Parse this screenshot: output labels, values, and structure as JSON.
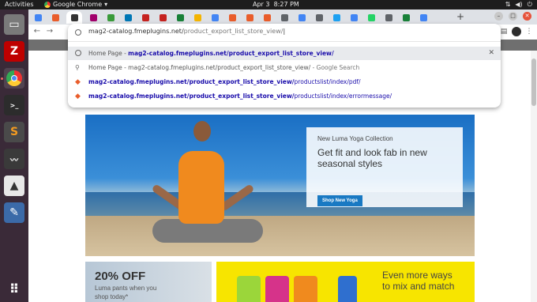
{
  "os_topbar": {
    "activities": "Activities",
    "app_name": "Google Chrome",
    "date": "Apr 3",
    "time": "8:27 PM"
  },
  "dock": {
    "items": [
      {
        "name": "files-icon",
        "glyph": "▭"
      },
      {
        "name": "filezilla-icon",
        "glyph": "Z"
      },
      {
        "name": "chrome-icon",
        "glyph": "◉"
      },
      {
        "name": "terminal-icon",
        "glyph": ">_"
      },
      {
        "name": "sublime-icon",
        "glyph": "S"
      },
      {
        "name": "system-monitor-icon",
        "glyph": "~"
      },
      {
        "name": "app-icon",
        "glyph": "▲"
      },
      {
        "name": "screenshot-icon",
        "glyph": "✎"
      },
      {
        "name": "show-apps-icon",
        "glyph": "⠿"
      }
    ]
  },
  "browser": {
    "tab_icon_colors": [
      "#4285f4",
      "#e95d2b",
      "#333333",
      "#a1006b",
      "#3a9b3a",
      "#0077b5",
      "#c5221f",
      "#c5221f",
      "#188038",
      "#f4b400",
      "#4285f4",
      "#e95d2b",
      "#e95d2b",
      "#e95d2b",
      "#5f6368",
      "#4285f4",
      "#5f6368",
      "#1da1f2",
      "#4285f4",
      "#25d366",
      "#5f6368",
      "#188038",
      "#4285f4"
    ],
    "new_tab": "+",
    "omnibox": {
      "typed_host": "mag2-catalog.fmeplugins.net/",
      "typed_path": "product_export_list_store_view/"
    },
    "suggestions": [
      {
        "icon": "globe-icon",
        "prefix": "Home Page - ",
        "link_bold": "mag2-catalog.fmeplugins.net/product_export_list_store_view/",
        "link_rest": "",
        "suffix": "",
        "removable": true
      },
      {
        "icon": "search-icon",
        "prefix": "",
        "link_bold": "",
        "link_rest": "",
        "plain": "Home Page - mag2-catalog.fmeplugins.net/product_export_list_store_view/",
        "suffix": " - Google Search",
        "removable": false
      },
      {
        "icon": "magento-icon",
        "prefix": "",
        "link_bold": "mag2-catalog.fmeplugins.net/product_export_list_store_view/",
        "link_rest": "productslist/index/pdf/",
        "suffix": "",
        "removable": false
      },
      {
        "icon": "magento-icon",
        "prefix": "",
        "link_bold": "mag2-catalog.fmeplugins.net/product_export_list_store_view/",
        "link_rest": "productslist/index/errormessage/",
        "suffix": "",
        "removable": false
      }
    ]
  },
  "page": {
    "hero": {
      "kicker": "New Luma Yoga Collection",
      "headline": "Get fit and look fab in new seasonal styles",
      "cta": "Shop New Yoga"
    },
    "tile_left": {
      "big": "20% OFF",
      "small1": "Luma pants when you",
      "small2": "shop today*"
    },
    "tile_right": {
      "line1": "Even more ways",
      "line2": "to mix and match"
    }
  }
}
